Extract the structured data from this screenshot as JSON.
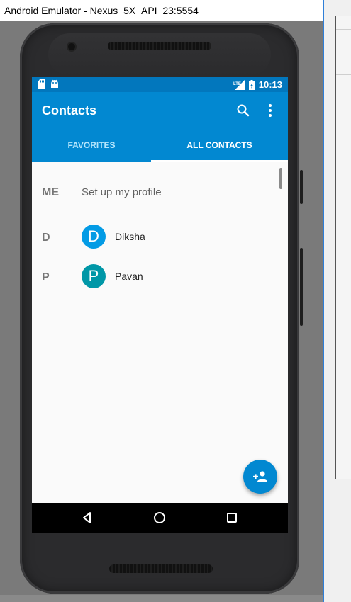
{
  "window": {
    "title": "Android Emulator - Nexus_5X_API_23:5554"
  },
  "status_bar": {
    "time": "10:13",
    "network": "LTE",
    "icons": [
      "sd-card-icon",
      "android-icon",
      "lte-signal-icon",
      "battery-charging-icon"
    ]
  },
  "app_bar": {
    "title": "Contacts",
    "actions": [
      "search-icon",
      "overflow-menu-icon"
    ]
  },
  "tabs": [
    {
      "label": "FAVORITES",
      "selected": false
    },
    {
      "label": "ALL CONTACTS",
      "selected": true
    }
  ],
  "profile": {
    "section": "ME",
    "label": "Set up my profile"
  },
  "contacts": [
    {
      "section": "D",
      "initial": "D",
      "name": "Diksha",
      "color": "#039be5"
    },
    {
      "section": "P",
      "initial": "P",
      "name": "Pavan",
      "color": "#0097a7"
    }
  ],
  "fab": {
    "icon": "add-person-icon"
  },
  "nav": [
    "back-icon",
    "home-icon",
    "recents-icon"
  ],
  "colors": {
    "primary": "#0288d1",
    "primary_dark": "#0277bd",
    "accent_tab": "#b3e5fc"
  }
}
